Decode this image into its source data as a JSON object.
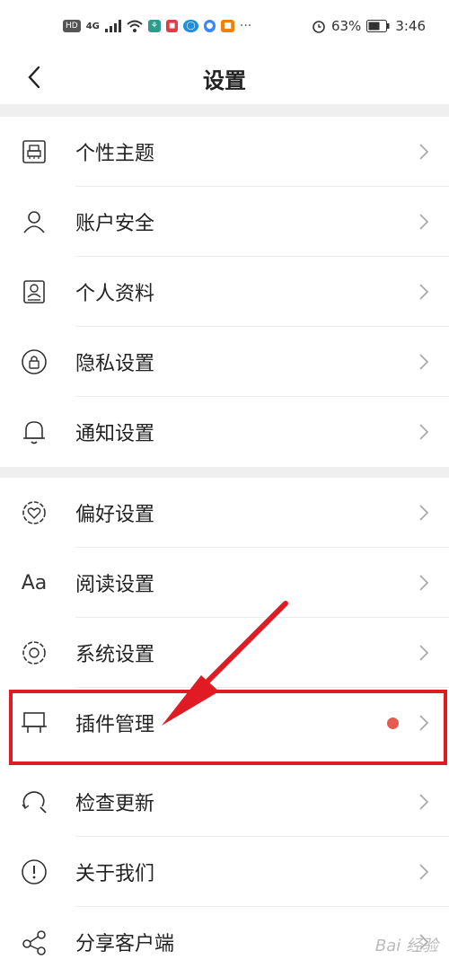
{
  "status_bar": {
    "hd": "HD",
    "signal": "4G",
    "battery": "63%",
    "time": "3:46"
  },
  "header": {
    "title": "设置"
  },
  "section1": [
    {
      "label": "个性主题",
      "icon": "theme-brush-icon"
    },
    {
      "label": "账户安全",
      "icon": "person-icon"
    },
    {
      "label": "个人资料",
      "icon": "profile-card-icon"
    },
    {
      "label": "隐私设置",
      "icon": "lock-icon"
    },
    {
      "label": "通知设置",
      "icon": "bell-icon"
    }
  ],
  "section2": [
    {
      "label": "偏好设置",
      "icon": "heart-gear-icon"
    },
    {
      "label": "阅读设置",
      "icon": "text-aa-icon",
      "icon_text": "Aa"
    },
    {
      "label": "系统设置",
      "icon": "system-gear-icon"
    },
    {
      "label": "插件管理",
      "icon": "plugin-icon",
      "badge_color": "#e85a4f"
    },
    {
      "label": "检查更新",
      "icon": "refresh-search-icon"
    },
    {
      "label": "关于我们",
      "icon": "info-icon"
    },
    {
      "label": "分享客户端",
      "icon": "share-icon"
    }
  ],
  "colors": {
    "highlight": "#e01b24",
    "badge": "#e85a4f",
    "divider_band": "#efefef"
  },
  "watermark": "Bai 经验"
}
